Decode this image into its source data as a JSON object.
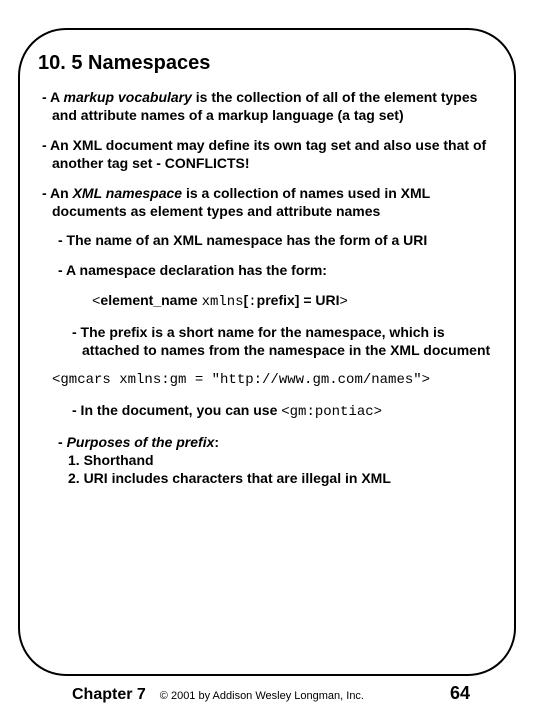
{
  "title": "10. 5 Namespaces",
  "p1_a": "- A ",
  "p1_b": "markup vocabulary",
  "p1_c": " is the collection of all of the element types and attribute names of a markup language (a tag set)",
  "p2": "- An XML document may define its own tag set and also use that of another tag set - CONFLICTS!",
  "p3_a": "- An ",
  "p3_b": "XML namespace",
  "p3_c": " is a collection of names used in XML documents as element types and attribute names",
  "p4": "- The name of an XML namespace has the form of a URI",
  "p5": "- A namespace declaration has the form:",
  "decl_a": "<",
  "decl_b": "element_name ",
  "decl_c": "xmlns",
  "decl_d": "[",
  "decl_e": ":",
  "decl_f": "prefix] = URI",
  "decl_g": ">",
  "p6": "- The prefix is a short name for the namespace, which is attached to names from the namespace in the XML document",
  "code1": "<gmcars xmlns:gm = \"http://www.gm.com/names\">",
  "p7_a": "- In the document, you can use ",
  "p7_b": "<gm:pontiac>",
  "p8_a": "- ",
  "p8_b": "Purposes of the prefix",
  "p8_c": ":",
  "p8_d": "1. Shorthand",
  "p8_e": "2. URI includes characters that are illegal in XML",
  "footer": {
    "chapter": "Chapter 7",
    "copyright": "© 2001 by Addison Wesley Longman, Inc.",
    "page": "64"
  }
}
